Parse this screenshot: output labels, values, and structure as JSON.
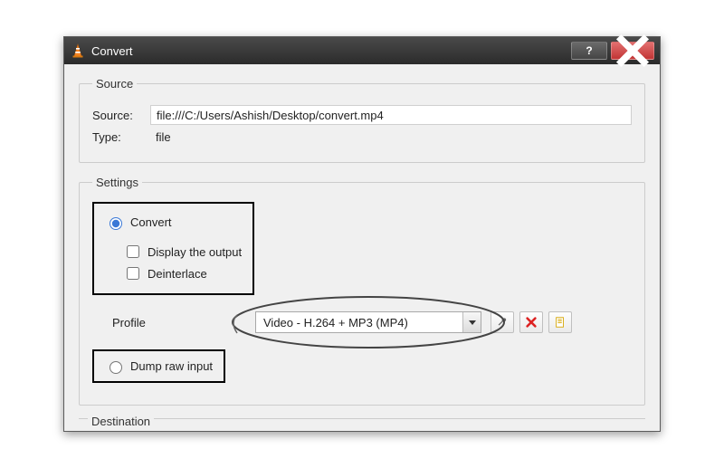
{
  "window": {
    "title": "Convert"
  },
  "source_group": {
    "legend": "Source",
    "source_label": "Source:",
    "source_value": "file:///C:/Users/Ashish/Desktop/convert.mp4",
    "type_label": "Type:",
    "type_value": "file"
  },
  "settings_group": {
    "legend": "Settings",
    "convert_label": "Convert",
    "display_output_label": "Display the output",
    "deinterlace_label": "Deinterlace",
    "profile_label": "Profile",
    "profile_value": "Video - H.264 + MP3 (MP4)",
    "dump_raw_label": "Dump raw input"
  },
  "destination_group": {
    "legend": "Destination"
  }
}
